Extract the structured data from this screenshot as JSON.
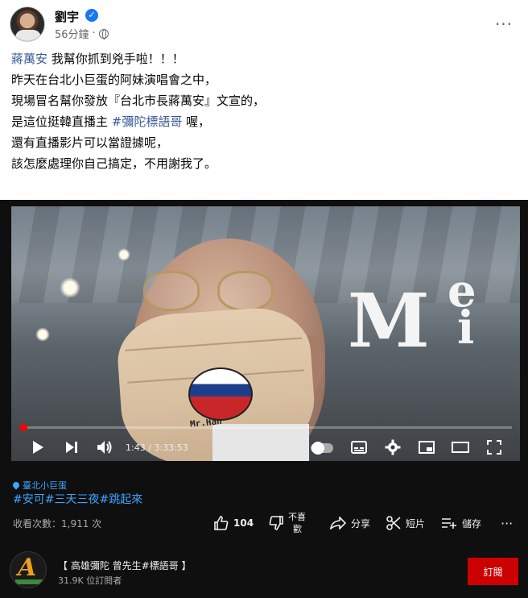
{
  "post": {
    "author": "劉宇",
    "verified_mark": "✓",
    "time": "56分鐘",
    "audience_icon": "globe-icon",
    "more_label": "···",
    "lines": [
      {
        "link": "蔣萬安",
        "text": " 我幫你抓到兇手啦！！！"
      },
      {
        "text": "昨天在台北小巨蛋的阿妹演唱會之中，"
      },
      {
        "text": "現場冒名幫你發放『台北市長蔣萬安』文宣的，"
      },
      {
        "pre": "是這位挺韓直播主 ",
        "link": "#彌陀標語哥",
        "post": " 喔，"
      },
      {
        "text": "還有直播影片可以當證據呢，"
      },
      {
        "text": "該怎麼處理你自己搞定，不用謝我了。"
      }
    ]
  },
  "video": {
    "logo_main": "M",
    "logo_e": "e",
    "logo_i": "i",
    "mask_text": "Mr.Han",
    "progress_fraction": 0.0077,
    "time_display": "1:43 / 3:33:53"
  },
  "embed": {
    "location": "臺北小巨蛋",
    "hashtags": "#安可#三天三夜#跳起來",
    "views": "收看次數：1,911 次",
    "like_count": "104",
    "dislike_line1": "不喜",
    "dislike_line2": "歡",
    "share_label": "分享",
    "clip_label": "短片",
    "save_label": "儲存",
    "more_label": "···",
    "channel_name": "【 高雄彌陀 曾先生#標語哥 】",
    "subscribers": "31.9K 位訂閱者",
    "subscribe_label": "訂閱"
  }
}
